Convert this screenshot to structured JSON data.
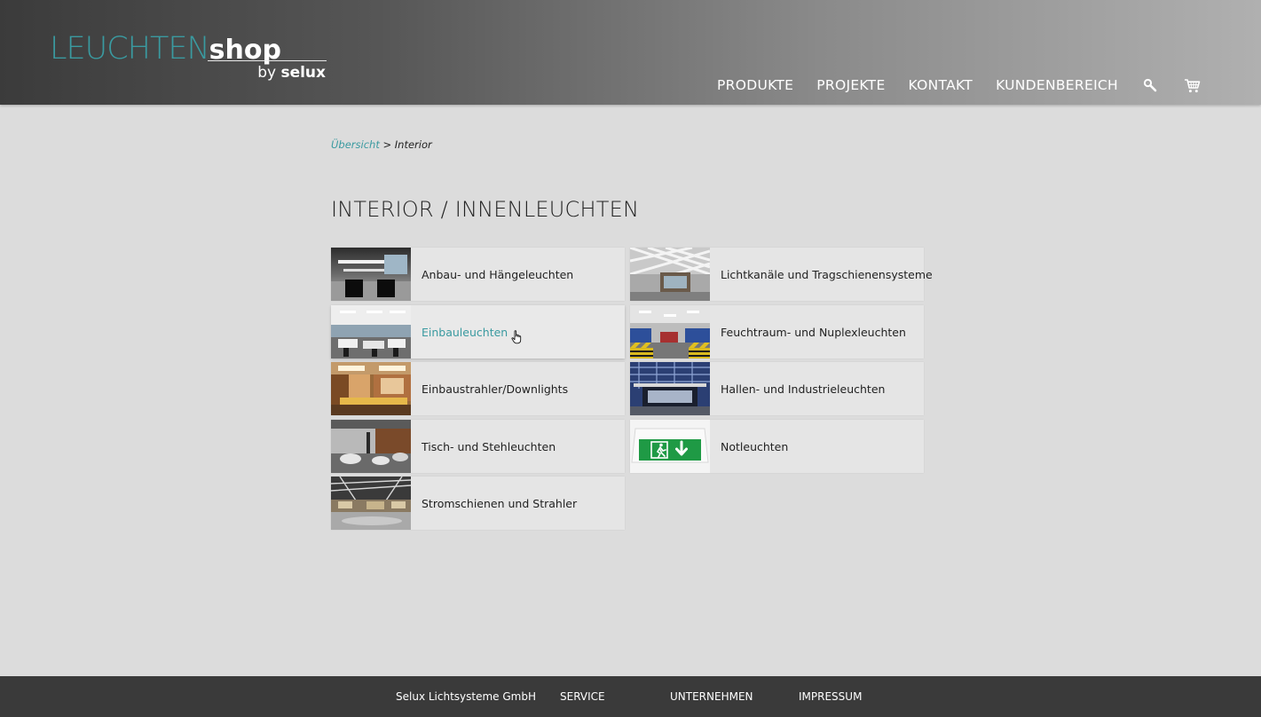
{
  "header": {
    "logo": {
      "leuchten": "LEUCHTEN",
      "shop": "shop",
      "by": "by",
      "brand": "selux"
    },
    "nav": [
      {
        "label": "PRODUKTE"
      },
      {
        "label": "PROJEKTE"
      },
      {
        "label": "KONTAKT"
      },
      {
        "label": "KUNDENBEREICH"
      }
    ],
    "icons": {
      "search": "search-icon",
      "cart": "cart-icon"
    }
  },
  "breadcrumb": {
    "root": "Übersicht",
    "separator": ">",
    "current": "Interior"
  },
  "page": {
    "title": "INTERIOR / INNENLEUCHTEN"
  },
  "categories": [
    {
      "label": "Anbau- und Hängeleuchten",
      "thumbnail": "office with suspended luminaires"
    },
    {
      "label": "Lichtkanäle und Tragschienensysteme",
      "thumbnail": "lobby with light channel ceiling"
    },
    {
      "label": "Einbauleuchten",
      "thumbnail": "open office with recessed lights",
      "state": "hover"
    },
    {
      "label": "Feuchtraum- und Nuplexleuchten",
      "thumbnail": "parking garage"
    },
    {
      "label": "Einbaustrahler/Downlights",
      "thumbnail": "conference room with downlights"
    },
    {
      "label": "Hallen- und Industrieleuchten",
      "thumbnail": "industrial hall"
    },
    {
      "label": "Tisch- und Stehleuchten",
      "thumbnail": "lounge with floor lamps"
    },
    {
      "label": "Notleuchten",
      "thumbnail": "green emergency exit sign"
    },
    {
      "label": "Stromschienen und Strahler",
      "thumbnail": "showroom with track lights"
    }
  ],
  "footer": {
    "links": [
      {
        "label": "Selux Lichtsysteme GmbH"
      },
      {
        "label": "SERVICE"
      },
      {
        "label": "UNTERNEHMEN"
      },
      {
        "label": "IMPRESSUM"
      }
    ]
  },
  "colors": {
    "accent": "#3a9aa0",
    "footer_bg": "#3a3a3a",
    "page_bg": "#dcdcdc",
    "tile_bg": "#e5e5e5",
    "exit_green": "#1f9a45"
  }
}
